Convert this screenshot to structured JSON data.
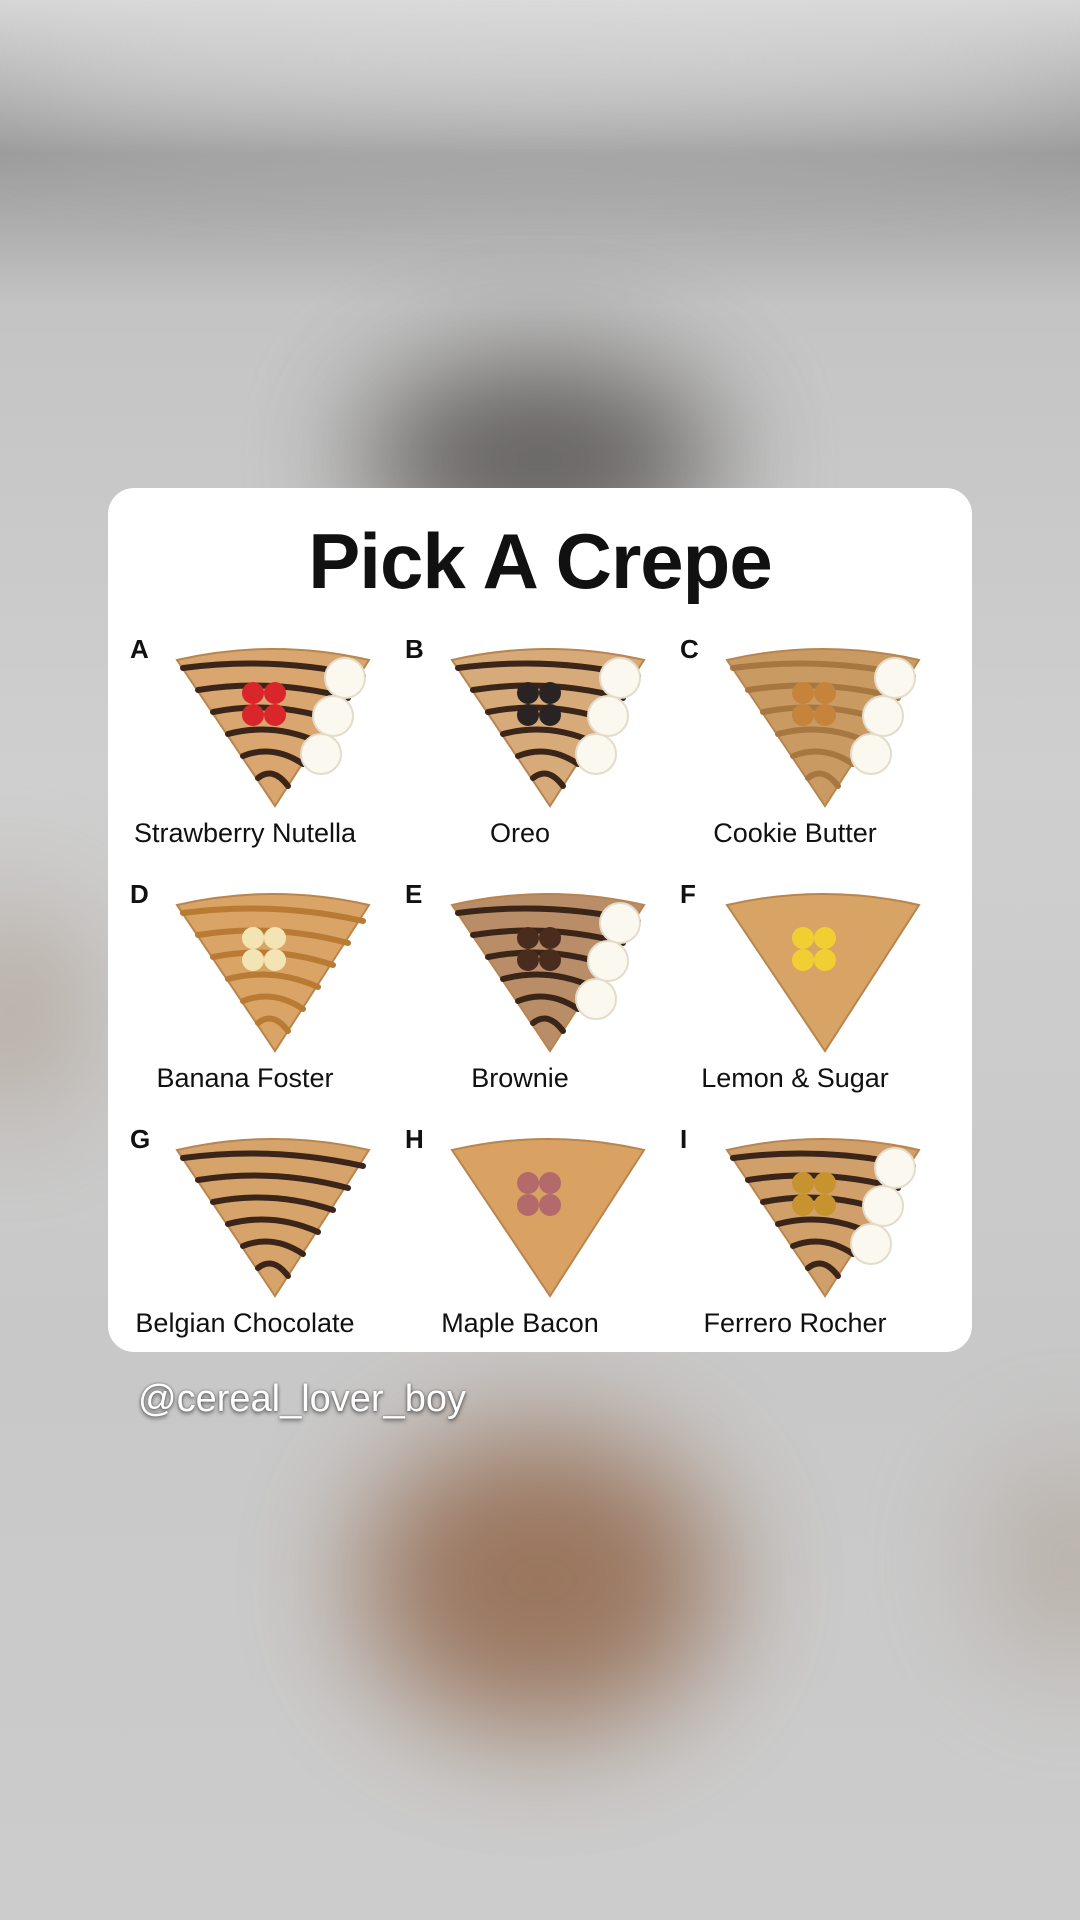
{
  "title": "Pick A Crepe",
  "handle": "@cereal_lover_boy",
  "options": [
    {
      "letter": "A",
      "label": "Strawberry Nutella",
      "icon": "strawberry-nutella-crepe-icon",
      "crepe": "#d8a66e",
      "drizzle": "#3b2418",
      "topping": "#d8262b",
      "cream": true
    },
    {
      "letter": "B",
      "label": "Oreo",
      "icon": "oreo-crepe-icon",
      "crepe": "#d7ab79",
      "drizzle": "#3b2418",
      "topping": "#2a2324",
      "cream": true
    },
    {
      "letter": "C",
      "label": "Cookie Butter",
      "icon": "cookie-butter-crepe-icon",
      "crepe": "#c99a62",
      "drizzle": "#a67740",
      "topping": "#c6833b",
      "cream": true
    },
    {
      "letter": "D",
      "label": "Banana Foster",
      "icon": "banana-foster-crepe-icon",
      "crepe": "#d9a465",
      "drizzle": "#b97a33",
      "topping": "#f3e4b3",
      "cream": false
    },
    {
      "letter": "E",
      "label": "Brownie",
      "icon": "brownie-crepe-icon",
      "crepe": "#b98d68",
      "drizzle": "#3b2418",
      "topping": "#4a2c1e",
      "cream": true
    },
    {
      "letter": "F",
      "label": "Lemon & Sugar",
      "icon": "lemon-sugar-crepe-icon",
      "crepe": "#d7a466",
      "drizzle": "",
      "topping": "#f1cf33",
      "cream": false
    },
    {
      "letter": "G",
      "label": "Belgian Chocolate",
      "icon": "belgian-chocolate-crepe-icon",
      "crepe": "#d6a46a",
      "drizzle": "#3b2418",
      "topping": "",
      "cream": false
    },
    {
      "letter": "H",
      "label": "Maple Bacon",
      "icon": "maple-bacon-crepe-icon",
      "crepe": "#d9a262",
      "drizzle": "",
      "topping": "#b46a6a",
      "cream": false
    },
    {
      "letter": "I",
      "label": "Ferrero Rocher",
      "icon": "ferrero-rocher-crepe-icon",
      "crepe": "#d1a06a",
      "drizzle": "#3b2418",
      "topping": "#c6932f",
      "cream": true
    }
  ]
}
